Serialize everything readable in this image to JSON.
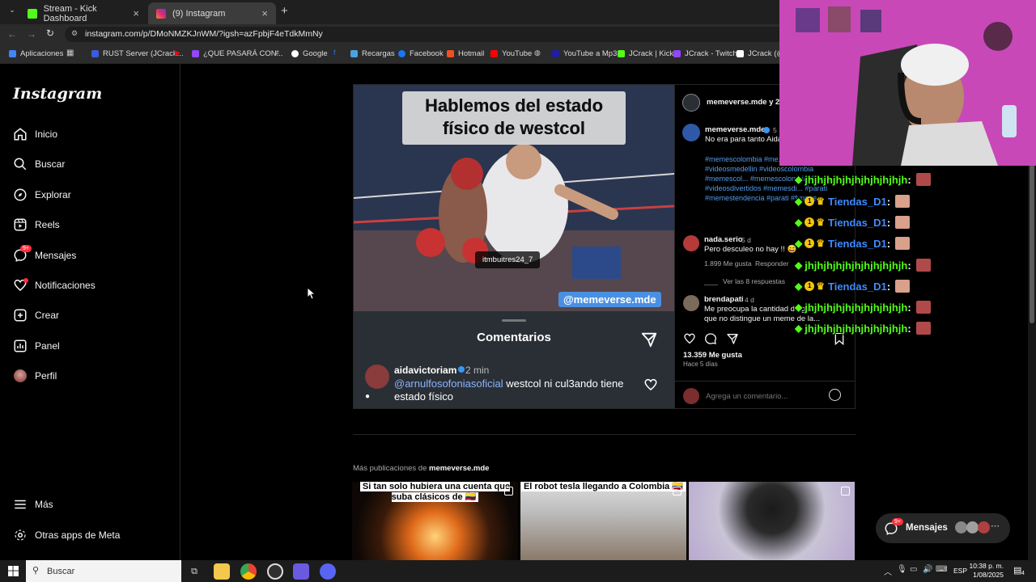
{
  "browser": {
    "tabs": [
      {
        "label": "Stream - Kick Dashboard",
        "active": false,
        "color": "#53fc18"
      },
      {
        "label": "(9) Instagram",
        "active": true,
        "color": "#d6249f"
      }
    ],
    "url": "instagram.com/p/DMoNMZKJnWM/?igsh=azFpbjF4eTdkMmNy",
    "bookmarks": [
      {
        "label": "Aplicaciones",
        "color": "#888888"
      },
      {
        "label": "RUST Server (JCrack...",
        "color": "#3b5bdb"
      },
      {
        "label": "¿QUE PASARÁ CON...",
        "color": "#9146ff"
      },
      {
        "label": "Google",
        "color": "#ffffff"
      },
      {
        "label": "Recargas",
        "color": "#4aa3df"
      },
      {
        "label": "Facebook",
        "color": "#1877f2"
      },
      {
        "label": "Hotmail",
        "color": "#f25022"
      },
      {
        "label": "YouTube",
        "color": "#ff0000"
      },
      {
        "label": "YouTube a Mp3",
        "color": "#1f1f9f"
      },
      {
        "label": "JCrack | Kick",
        "color": "#53fc18"
      },
      {
        "label": "JCrack - Twitch",
        "color": "#9146ff"
      },
      {
        "label": "JCrack (@JC",
        "color": "#ffffff"
      }
    ]
  },
  "instagram": {
    "logo": "Instagram",
    "nav": [
      {
        "label": "Inicio",
        "icon": "home-icon"
      },
      {
        "label": "Buscar",
        "icon": "search-icon"
      },
      {
        "label": "Explorar",
        "icon": "compass-icon"
      },
      {
        "label": "Reels",
        "icon": "reels-icon"
      },
      {
        "label": "Mensajes",
        "icon": "messenger-icon",
        "badge": "9+"
      },
      {
        "label": "Notificaciones",
        "icon": "heart-icon",
        "dot": true
      },
      {
        "label": "Crear",
        "icon": "plus-square-icon"
      },
      {
        "label": "Panel",
        "icon": "dashboard-icon"
      },
      {
        "label": "Perfil",
        "icon": "avatar"
      }
    ],
    "nav_bottom": [
      {
        "label": "Más",
        "icon": "menu-icon"
      },
      {
        "label": "Otras apps de Meta",
        "icon": "meta-icon"
      }
    ]
  },
  "post": {
    "media": {
      "title_line1": "Hablemos del estado",
      "title_line2": "físico de westcol",
      "tag_chip": "itmbuitres24_7",
      "watermark": "@memeverse.mde",
      "comments_title": "Comentarios",
      "comment_user": "aidavictoriam",
      "comment_time": "2 min",
      "comment_mention": "@arnulfosofoniasoficial",
      "comment_text": " westcol ni cul3ando tiene estado físico"
    },
    "header": "memeverse.mde y 2 p",
    "caption": {
      "user": "memeverse.mde",
      "time": "5",
      "text": "No era para tanto Aida",
      "hashtags": "#memescolombia #me... #fypreals #fypreals #videosmedellin #videoscolombia #memescol... #memescolombiaoficial #videosdivertidos #memesdi... #parati #memestendencia #parati #fypage"
    },
    "comments": [
      {
        "user": "nada.serio",
        "time": "5 d",
        "text": "Pero desculeo no hay !! 😅",
        "likes": "1.899 Me gusta",
        "reply": "Responder",
        "view_replies": "Ver las 8 respuestas"
      },
      {
        "user": "brendapati",
        "time": "4 d",
        "text": "Me preocupa la cantidad de gen...",
        "text2": "que no distingue un meme de la..."
      }
    ],
    "likes": "13.359 Me gusta",
    "date": "Hace 5 días",
    "add_comment_placeholder": "Agrega un comentario..."
  },
  "more": {
    "label_prefix": "Más publicaciones de ",
    "label_user": "memeverse.mde",
    "thumbs": [
      {
        "caption": "Si tan solo hubiera una cuenta que suba clásicos de 🇨🇴"
      },
      {
        "caption": "El robot tesla llegando a Colombia 🇨🇴"
      },
      {
        "caption": ""
      }
    ]
  },
  "messages_pill": {
    "label": "Mensajes",
    "badge": "9+"
  },
  "stream_chat": [
    {
      "name": "jhjhjhjhjhjhjhjhjhjhjh",
      "color": "#53fc18",
      "badges": false
    },
    {
      "name": "Tiendas_D1",
      "color": "#3d8bff",
      "badges": true
    },
    {
      "name": "Tiendas_D1",
      "color": "#3d8bff",
      "badges": true
    },
    {
      "name": "Tiendas_D1",
      "color": "#3d8bff",
      "badges": true
    },
    {
      "name": "jhjhjhjhjhjhjhjhjhjhjh",
      "color": "#53fc18",
      "badges": false
    },
    {
      "name": "Tiendas_D1",
      "color": "#3d8bff",
      "badges": true
    },
    {
      "name": "jhjhjhjhjhjhjhjhjhjhjh",
      "color": "#53fc18",
      "badges": false
    },
    {
      "name": "jhjhjhjhjhjhjhjhjhjhjh",
      "color": "#53fc18",
      "badges": false
    }
  ],
  "taskbar": {
    "search_placeholder": "Buscar",
    "lang": "ESP",
    "time": "10:38 p. m.",
    "date": "1/08/2025",
    "notif": "4"
  }
}
